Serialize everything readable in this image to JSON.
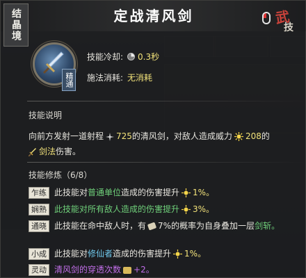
{
  "realm_badge": "结晶境",
  "title": "定战清风剑",
  "corner": {
    "wu": "武",
    "ji": "技"
  },
  "skill": {
    "mastery_tag": "精通"
  },
  "stats": {
    "cooldown_label": "技能冷却:",
    "cooldown_value": "0.3秒",
    "cost_label": "施法消耗:",
    "cost_value": "无消耗"
  },
  "description": {
    "heading": "技能说明",
    "part1": "向前方发射一道射程",
    "range": "725",
    "part2": "的清风剑，对敌人造成威力",
    "power": "208",
    "part3": "的",
    "damage_type": "剑法",
    "part4": "伤害。"
  },
  "modifiers": {
    "heading": "技能修炼（6/8）",
    "items": [
      {
        "tag": "乍练",
        "pre": "此技能对",
        "hl": "普通单位",
        "hl_color": "green",
        "post": "造成的伤害提升",
        "val": "1%。",
        "val_color": "yellow",
        "icon": "sun-icon"
      },
      {
        "tag": "娴熟",
        "pre": "此技能对所有敌人造成的伤害提升",
        "hl": "",
        "hl_color": "green",
        "post": "",
        "val": "3%。",
        "val_color": "yellow",
        "icon": "sun-icon",
        "all_green": true
      },
      {
        "tag": "通晓",
        "pre": "此技能在命中敌人时，有",
        "hl": "",
        "hl_color": "",
        "post": "7%的概率为自身叠加一层",
        "val": "剑斩。",
        "val_color": "green",
        "icon": "chip-icon"
      },
      {
        "tag": "小成",
        "pre": "此技能对",
        "hl": "修仙者",
        "hl_color": "cyan",
        "post": "造成的伤害提升",
        "val": "1%。",
        "val_color": "yellow",
        "icon": "sun-icon"
      },
      {
        "tag": "灵动",
        "pre": "清风剑的穿透次数",
        "hl": "",
        "hl_color": "purple",
        "post": "",
        "val": "+2。",
        "val_color": "purple",
        "icon": "scroll-icon",
        "all_purple": true
      }
    ]
  },
  "colors": {
    "yellow": "#f2e27a",
    "green": "#6fd07a",
    "cyan": "#6fc7ea",
    "purple": "#c16ee8"
  }
}
